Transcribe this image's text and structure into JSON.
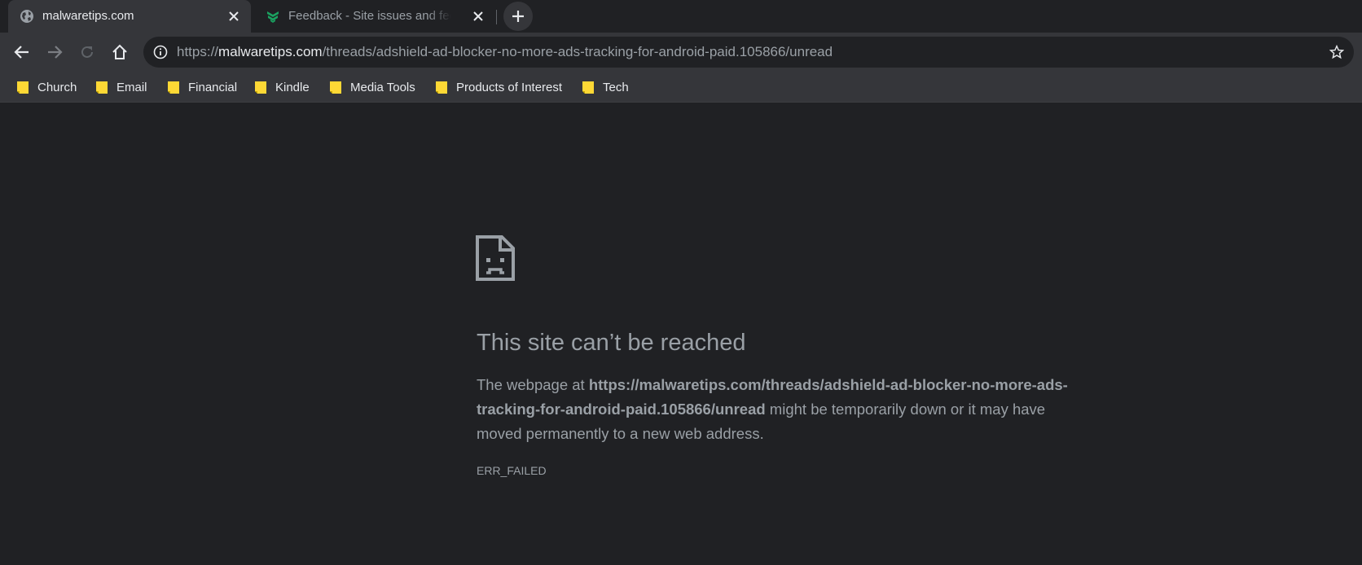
{
  "tabs": [
    {
      "title": "malwaretips.com",
      "favicon": "globe-icon",
      "active": true
    },
    {
      "title": "Feedback - Site issues and feedback",
      "favicon": "malwaretips-logo-icon",
      "active": false
    }
  ],
  "toolbar": {
    "url_scheme": "https://",
    "url_host": "malwaretips.com",
    "url_path": "/threads/adshield-ad-blocker-no-more-ads-tracking-for-android-paid.105866/unread"
  },
  "bookmarks": [
    {
      "label": "Church"
    },
    {
      "label": "Email"
    },
    {
      "label": "Financial"
    },
    {
      "label": "Kindle"
    },
    {
      "label": "Media Tools"
    },
    {
      "label": "Products of Interest"
    },
    {
      "label": "Tech"
    }
  ],
  "error": {
    "title": "This site can’t be reached",
    "desc_prefix": "The webpage at ",
    "desc_url": "https://malwaretips.com/threads/adshield-ad-blocker-no-more-ads-tracking-for-android-paid.105866/unread",
    "desc_suffix": " might be temporarily down or it may have moved permanently to a new web address.",
    "code": "ERR_FAILED"
  },
  "colors": {
    "background": "#202124",
    "toolbar": "#35363a",
    "text_primary": "#e8eaed",
    "text_muted": "#9aa0a6",
    "folder": "#fdd835",
    "brand_accent": "#1aa260"
  }
}
